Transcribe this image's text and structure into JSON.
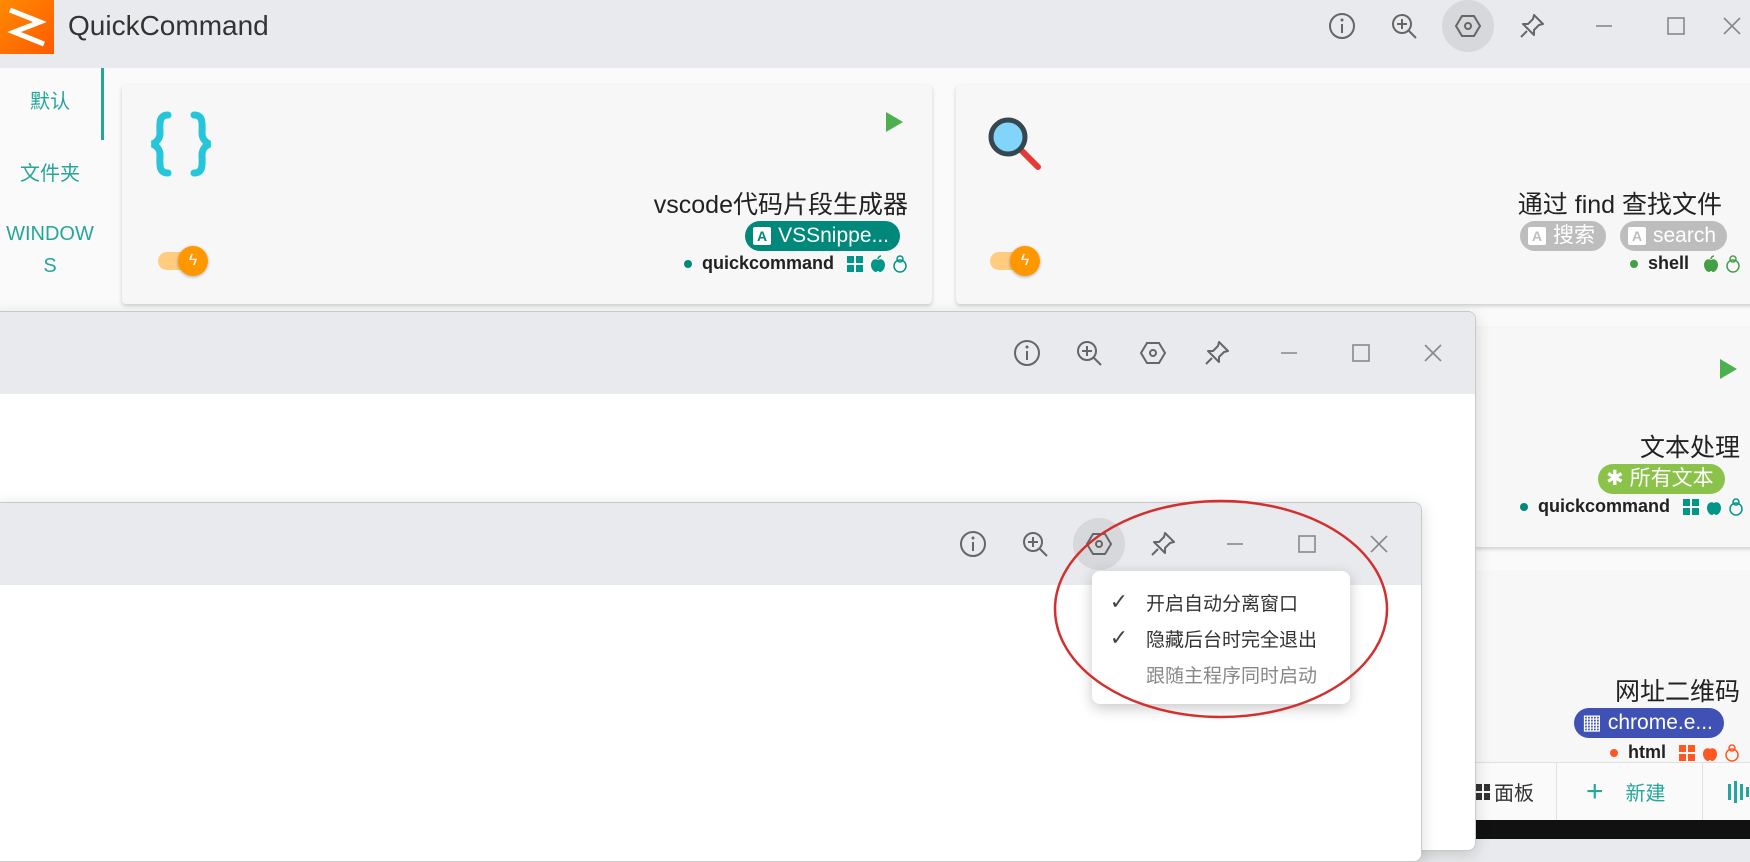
{
  "app": {
    "title": "QuickCommand"
  },
  "titlebar": {
    "icons": [
      "info-icon",
      "zoom-in-icon",
      "settings-hexagon-icon",
      "pin-icon",
      "minimize-icon",
      "maximize-icon",
      "close-icon"
    ]
  },
  "sidebar": {
    "items": [
      {
        "label": "默认",
        "active": true
      },
      {
        "label": "文件夹",
        "active": false
      },
      {
        "label": "WINDOW",
        "label2": "S",
        "active": false
      }
    ]
  },
  "cards": [
    {
      "icon": "curly-braces-icon",
      "title": "vscode代码片段生成器",
      "tags": [
        {
          "icon": "A",
          "text": "VSSnippe...",
          "color": "#00897b"
        }
      ],
      "meta": {
        "dot_color": "#00897b",
        "type": "quickcommand",
        "platforms": [
          "windows-icon",
          "apple-icon",
          "linux-icon"
        ],
        "platform_color": "#009688"
      }
    },
    {
      "icon": "magnifier-icon",
      "title": "通过 find 查找文件",
      "tags": [
        {
          "icon": "A",
          "text": "搜索",
          "color": "#bdbdbd"
        },
        {
          "icon": "A",
          "text": "search",
          "color": "#bdbdbd"
        }
      ],
      "meta": {
        "dot_color": "#43a047",
        "type": "shell",
        "platforms": [
          "apple-icon",
          "linux-icon"
        ],
        "platform_color": "#43a047"
      }
    },
    {
      "title": "文本处理",
      "tags": [
        {
          "icon": "✱",
          "text": "所有文本",
          "color": "#8bc34a"
        }
      ],
      "meta": {
        "dot_color": "#00897b",
        "type": "quickcommand",
        "platforms": [
          "windows-icon",
          "apple-icon",
          "linux-icon"
        ],
        "platform_color": "#009688"
      }
    },
    {
      "title": "网址二维码",
      "tags": [
        {
          "icon": "▦",
          "text": "chrome.e...",
          "color": "#3f51b5"
        }
      ],
      "meta": {
        "dot_color": "#ff5722",
        "type": "html",
        "platforms": [
          "windows-icon",
          "apple-icon",
          "linux-icon"
        ],
        "platform_color": "#ff5722"
      }
    }
  ],
  "menu": {
    "items": [
      {
        "label": "开启自动分离窗口",
        "checked": true,
        "disabled": false
      },
      {
        "label": "隐藏后台时完全退出",
        "checked": true,
        "disabled": false
      },
      {
        "label": "跟随主程序同时启动",
        "checked": false,
        "disabled": true
      }
    ]
  },
  "bottombar": {
    "panel_label": "面板",
    "new_label": "新建"
  },
  "colors": {
    "accent": "#26a69a",
    "annotation": "#d32f2f",
    "toggle": "#ff9800"
  }
}
